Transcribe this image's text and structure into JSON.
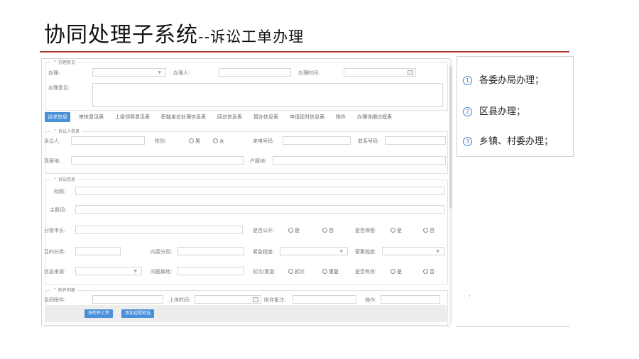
{
  "slide": {
    "title_main": "协同处理子系统",
    "title_sub": "--诉讼工单办理"
  },
  "handling": {
    "legend": "办理意见",
    "handle_label": "办理:",
    "handler_label": "办理人:",
    "handle_time_label": "办理时间:",
    "opinion_label": "办理意见:"
  },
  "tabs": [
    "诉求信息",
    "审核意见表",
    "上级领导意见表",
    "职能单位处理信息表",
    "回访信息表",
    "暂办信息表",
    "申请延时信息表",
    "附件",
    "办理详细过程表"
  ],
  "litigant": {
    "legend": "诉讼人信息",
    "name_label": "诉讼人:",
    "gender_label": "性别:",
    "male": "男",
    "female": "女",
    "incoming_phone_label": "来电号码:",
    "contact_phone_label": "联系号码:",
    "residence_label": "现居地:",
    "household_label": "户籍地:"
  },
  "complaint": {
    "legend": "诉讼信息",
    "title_label": "标题:",
    "subject_label": "主题词:",
    "mayor_label": "分管市长:",
    "public_label": "是否公开:",
    "secret_label": "是否保密:",
    "yes": "是",
    "no": "否",
    "purpose_label": "目的分类:",
    "content_label": "内容分类:",
    "urgency_label": "紧急程度:",
    "confidential_label": "密集程度:",
    "source_label": "信息来源:",
    "location_label": "问题属地:",
    "first_repeat_label": "初次/重复:",
    "first": "初次",
    "repeat": "重复",
    "valid_label": "是否有效:"
  },
  "attachments": {
    "legend": "附件列表",
    "file_label": "合同附件:",
    "upload_time_label": "上传时间:",
    "remark_label": "附件备注:",
    "operation_label": "操作:",
    "multi_upload": "多附件上传",
    "add_link": "添加远程地址"
  },
  "side": {
    "items": [
      {
        "num": "①",
        "text": "各委办局办理；"
      },
      {
        "num": "②",
        "text": "区县办理；"
      },
      {
        "num": "③",
        "text": "乡镇、村委办理；"
      }
    ]
  },
  "colors": {
    "accent": "#4a90d9",
    "title_rule": "#b03a3a"
  }
}
